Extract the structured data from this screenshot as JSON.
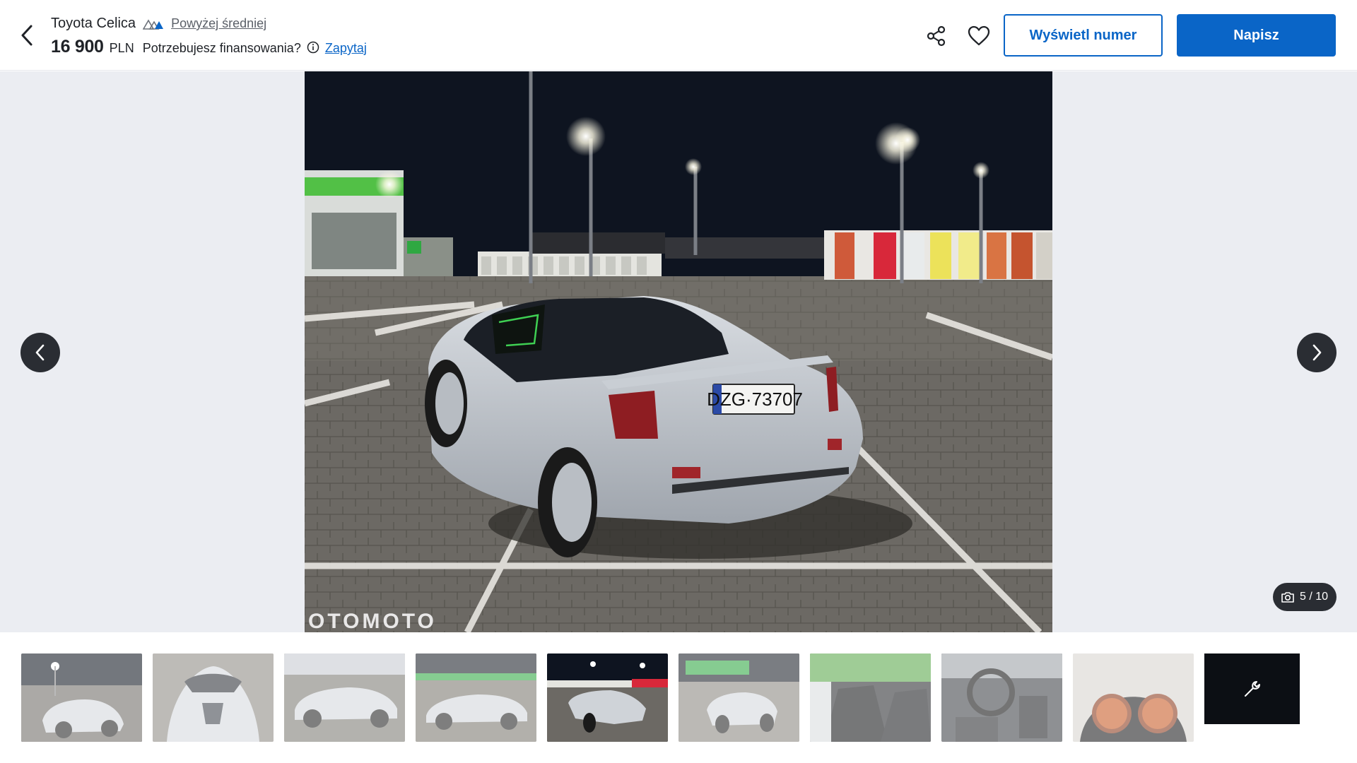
{
  "header": {
    "title": "Toyota Celica",
    "price_badge_label": "Powyżej średniej",
    "price_value": "16 900",
    "price_currency": "PLN",
    "finance_question": "Potrzebujesz finansowania?",
    "ask_link": "Zapytaj",
    "show_number_label": "Wyświetl numer",
    "write_label": "Napisz"
  },
  "colors": {
    "accent": "#0a65c7",
    "overlay": "#2a2d33",
    "gallery_bg": "#ebedf2"
  },
  "icons": {
    "back": "chevron-left-icon",
    "badge": "price-indicator-icon",
    "info": "info-icon",
    "share": "share-icon",
    "favorite": "heart-icon",
    "prev": "chevron-left-icon",
    "next": "chevron-right-icon",
    "camera": "camera-icon",
    "more": "wrench-icon"
  },
  "gallery": {
    "watermark": "OTOMOTO",
    "plate": "DZG·73707",
    "counter": "5 / 10",
    "current_index": 5,
    "total": 10,
    "thumbnails": [
      {
        "scene": "night-front"
      },
      {
        "scene": "hood"
      },
      {
        "scene": "side"
      },
      {
        "scene": "side"
      },
      {
        "scene": "night-rear",
        "active": true
      },
      {
        "scene": "rear-store"
      },
      {
        "scene": "interior"
      },
      {
        "scene": "dashboard"
      },
      {
        "scene": "gauges"
      }
    ]
  }
}
